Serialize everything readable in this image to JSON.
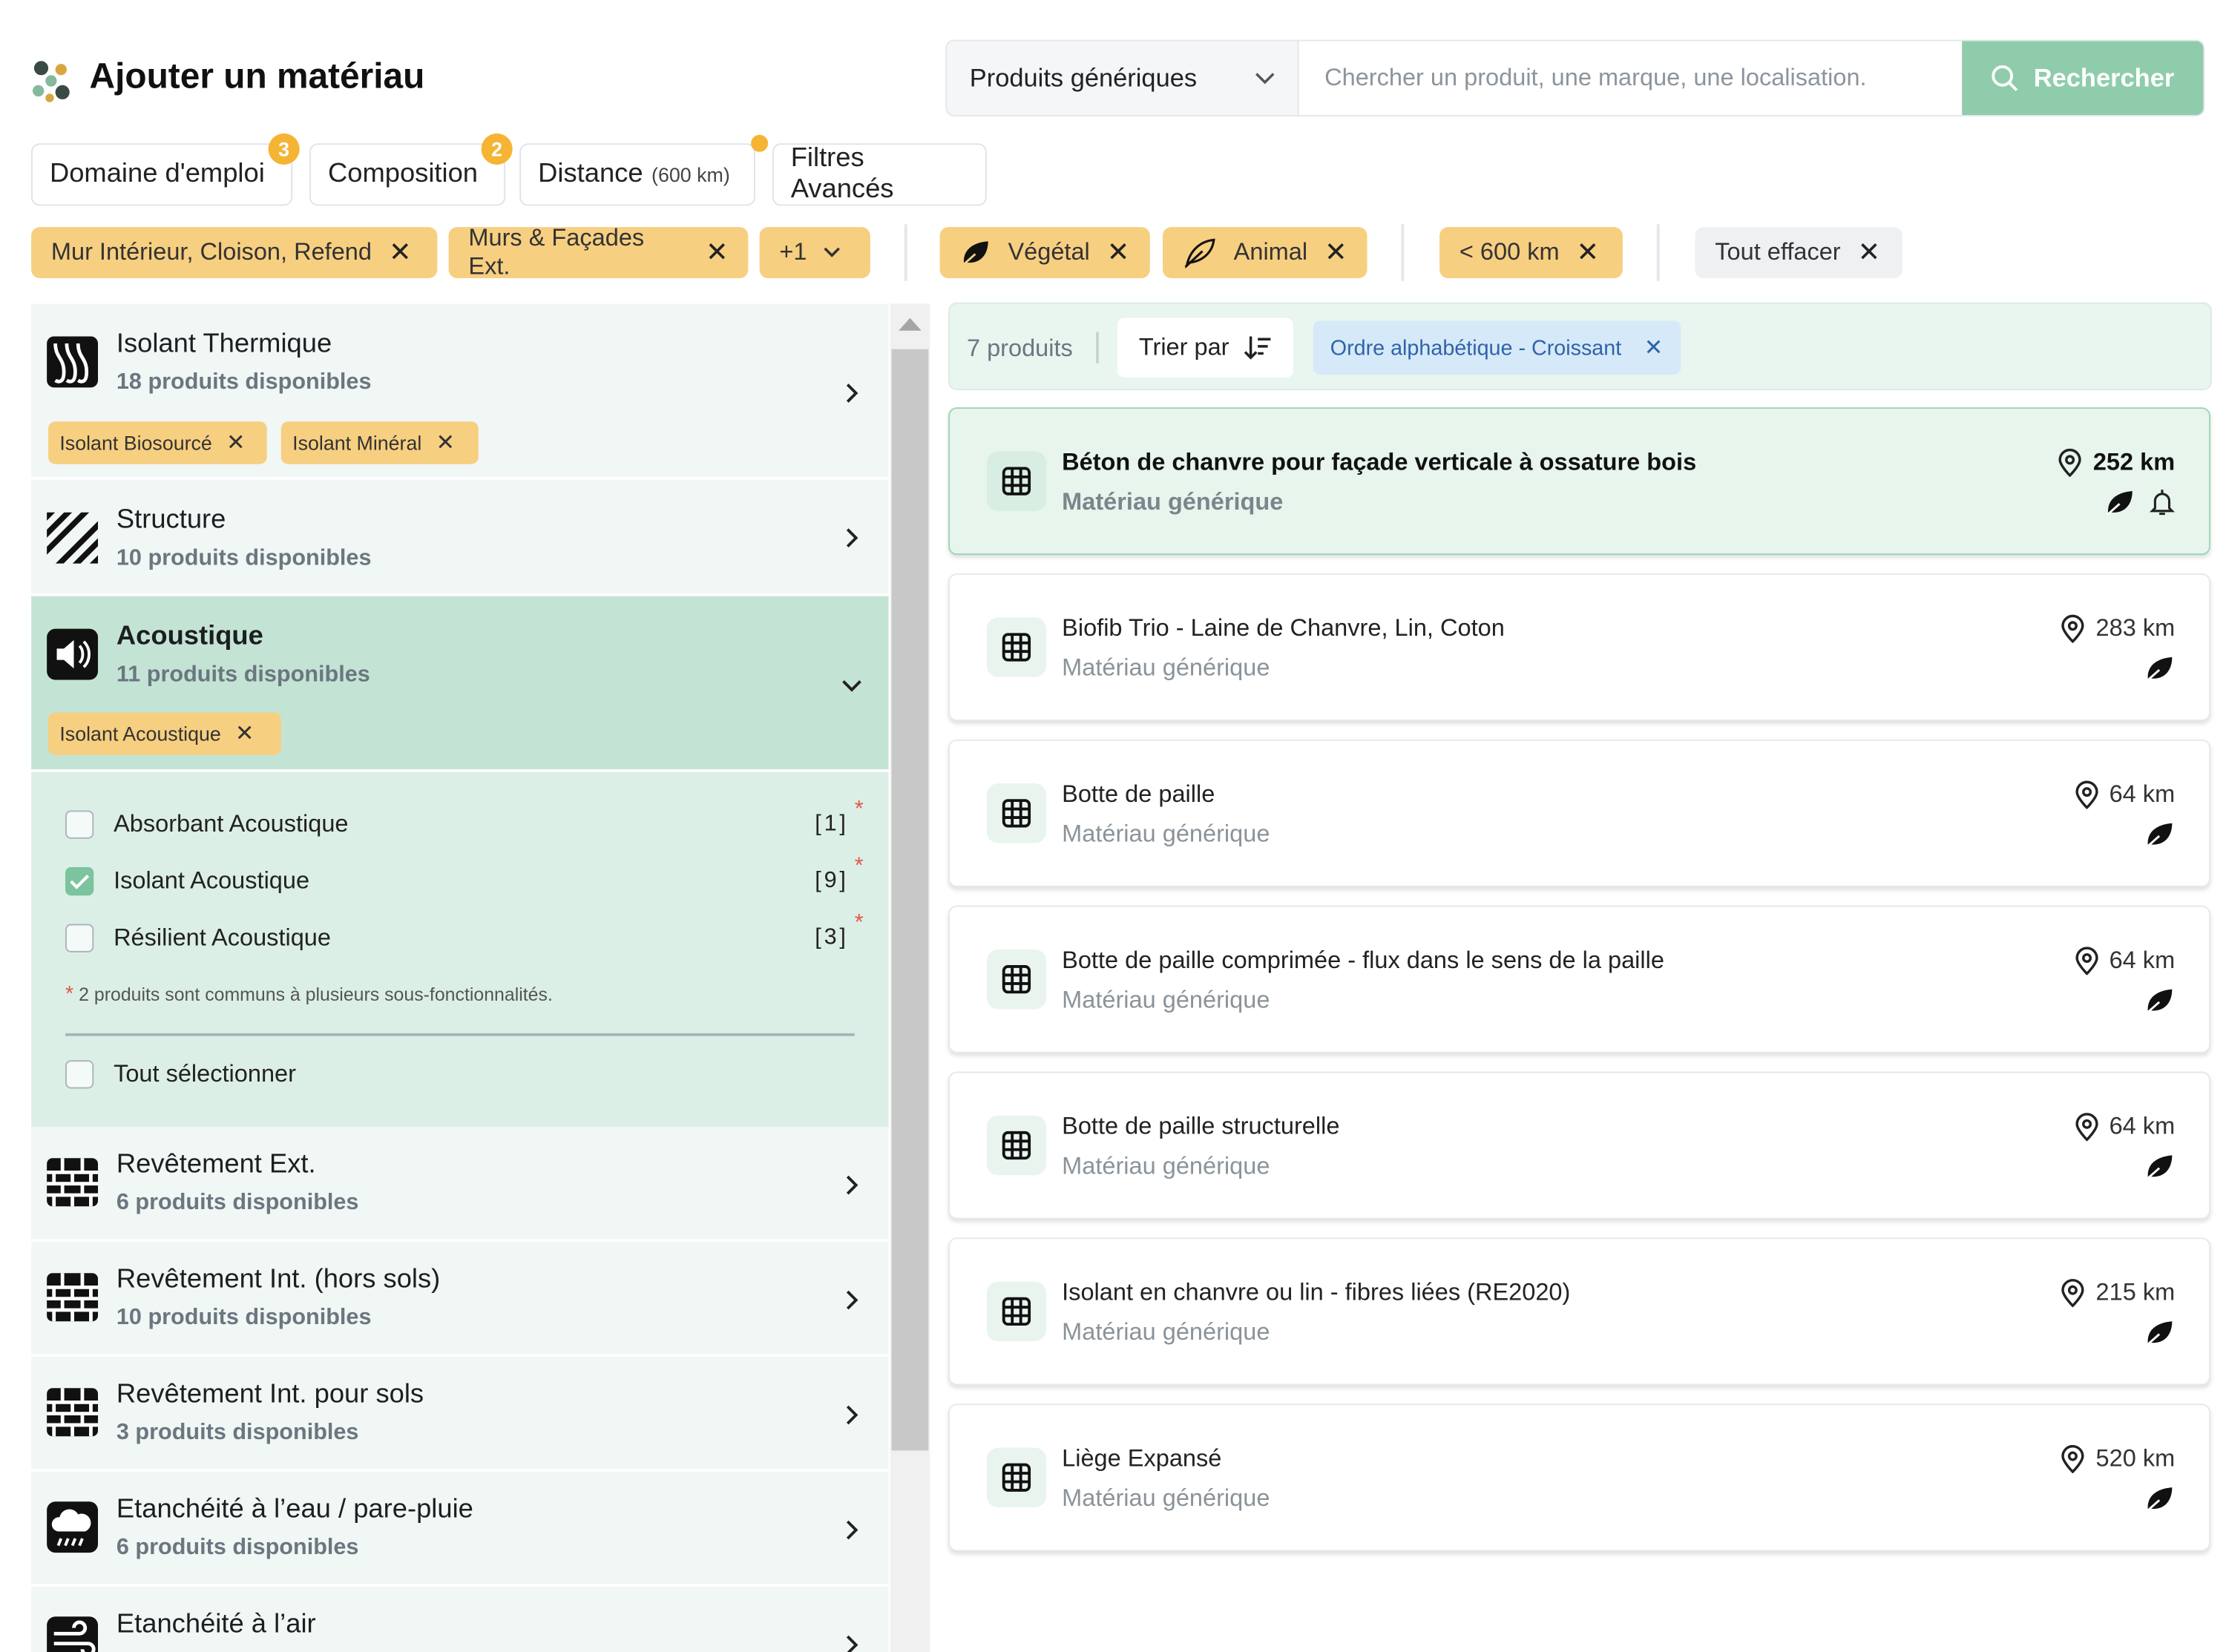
{
  "header": {
    "title": "Ajouter un matériau",
    "product_type": "Produits génériques",
    "search_placeholder": "Chercher un produit, une marque, une localisation.",
    "search_label": "Rechercher"
  },
  "filter_tabs": [
    {
      "label": "Domaine d'emploi",
      "badge": "3"
    },
    {
      "label": "Composition",
      "badge": "2"
    },
    {
      "label": "Distance",
      "sub": "(600 km)",
      "dot": true
    },
    {
      "label": "Filtres Avancés"
    }
  ],
  "active_filters": {
    "usage": [
      "Mur Intérieur, Cloison, Refend",
      "Murs & Façades Ext."
    ],
    "more": "+1",
    "composition": [
      "Végétal",
      "Animal"
    ],
    "distance": "< 600 km",
    "clear": "Tout effacer"
  },
  "categories": [
    {
      "name": "Isolant Thermique",
      "count": "18 produits disponibles",
      "chips": [
        "Isolant Biosourcé",
        "Isolant Minéral"
      ],
      "icon": "insulation-icon"
    },
    {
      "name": "Structure",
      "count": "10 produits disponibles",
      "icon": "structure-icon"
    },
    {
      "name": "Acoustique",
      "count": "11 produits disponibles",
      "chips": [
        "Isolant Acoustique"
      ],
      "icon": "speaker-icon",
      "expanded": true,
      "options": [
        {
          "label": "Absorbant Acoustique",
          "count": "[1]",
          "checked": false
        },
        {
          "label": "Isolant Acoustique",
          "count": "[9]",
          "checked": true
        },
        {
          "label": "Résilient Acoustique",
          "count": "[3]",
          "checked": false
        }
      ],
      "note": "2 produits sont communs à plusieurs sous-fonctionnalités.",
      "select_all": "Tout sélectionner"
    },
    {
      "name": "Revêtement Ext.",
      "count": "6 produits disponibles",
      "icon": "brick-icon"
    },
    {
      "name": "Revêtement Int. (hors sols)",
      "count": "10 produits disponibles",
      "icon": "brick-icon"
    },
    {
      "name": "Revêtement Int. pour sols",
      "count": "3 produits disponibles",
      "icon": "brick-icon"
    },
    {
      "name": "Etanchéité à l’eau / pare-pluie",
      "count": "6 produits disponibles",
      "icon": "rain-cloud-icon"
    },
    {
      "name": "Etanchéité à l’air",
      "icon": "air-icon"
    }
  ],
  "results": {
    "count": "7 produits",
    "sort_label": "Trier par",
    "sort_value": "Ordre alphabétique - Croissant",
    "items": [
      {
        "name": "Béton de chanvre pour façade verticale à ossature bois",
        "type": "Matériau générique",
        "distance": "252 km",
        "tags": [
          "leaf-icon",
          "bell-icon"
        ]
      },
      {
        "name": "Biofib Trio - Laine de Chanvre, Lin, Coton",
        "type": "Matériau générique",
        "distance": "283 km",
        "tags": [
          "leaf-icon"
        ]
      },
      {
        "name": "Botte de paille",
        "type": "Matériau générique",
        "distance": "64 km",
        "tags": [
          "leaf-icon"
        ]
      },
      {
        "name": "Botte de paille comprimée - flux dans le sens de la paille",
        "type": "Matériau générique",
        "distance": "64 km",
        "tags": [
          "leaf-icon"
        ]
      },
      {
        "name": "Botte de paille structurelle",
        "type": "Matériau générique",
        "distance": "64 km",
        "tags": [
          "leaf-icon"
        ]
      },
      {
        "name": "Isolant en chanvre ou lin - fibres liées (RE2020)",
        "type": "Matériau générique",
        "distance": "215 km",
        "tags": [
          "leaf-icon"
        ]
      },
      {
        "name": "Liège Expansé",
        "type": "Matériau générique",
        "distance": "520 km",
        "tags": [
          "leaf-icon"
        ]
      }
    ]
  },
  "colors": {
    "accent": "#8fccab",
    "badge": "#f5b433",
    "chip": "#f7cf80",
    "selected": "#c3e4d4"
  }
}
